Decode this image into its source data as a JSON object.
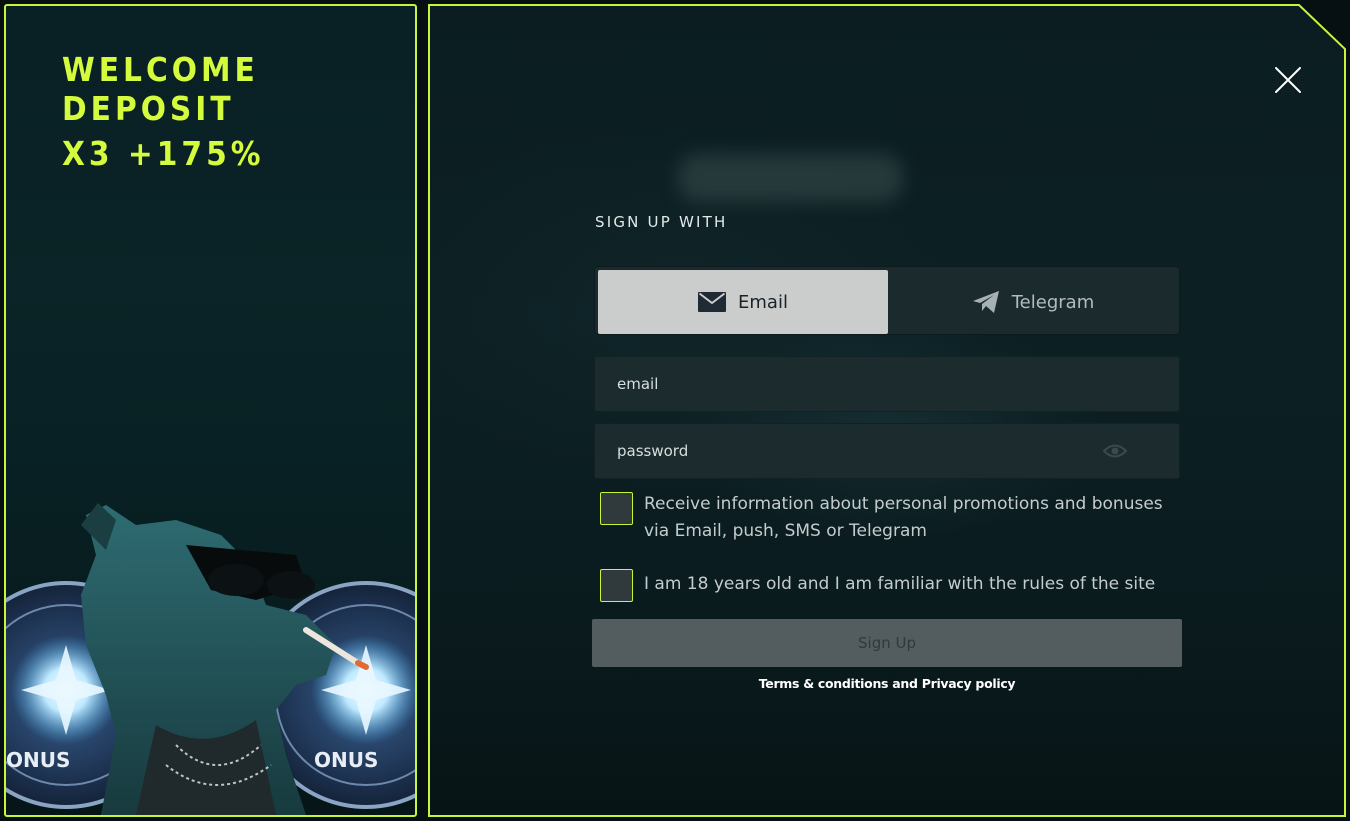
{
  "promo": {
    "line1": "WELCOME",
    "line2": "DEPOSIT",
    "line3": "X3 +175%",
    "badge_text": "ONUS"
  },
  "modal": {
    "close_icon": "close-icon",
    "heading": "SIGN UP WITH",
    "tabs": [
      {
        "label": "Email",
        "icon": "envelope-icon",
        "selected": true
      },
      {
        "label": "Telegram",
        "icon": "telegram-icon",
        "selected": false
      }
    ],
    "email_placeholder": "email",
    "password_placeholder": "password",
    "checkbox_promotions": "Receive information about personal promotions and bonuses via Email, push, SMS or Telegram",
    "checkbox_age": "I am 18 years old and I am familiar with the rules of the site",
    "submit_label": "Sign Up",
    "legal_terms": "Terms & conditions",
    "legal_and": "and",
    "legal_privacy": "Privacy policy"
  },
  "colors": {
    "accent": "#c8f53a",
    "background": "#0b1d21",
    "tab_selected": "#cbcdcd",
    "button_disabled": "#535d5f"
  }
}
